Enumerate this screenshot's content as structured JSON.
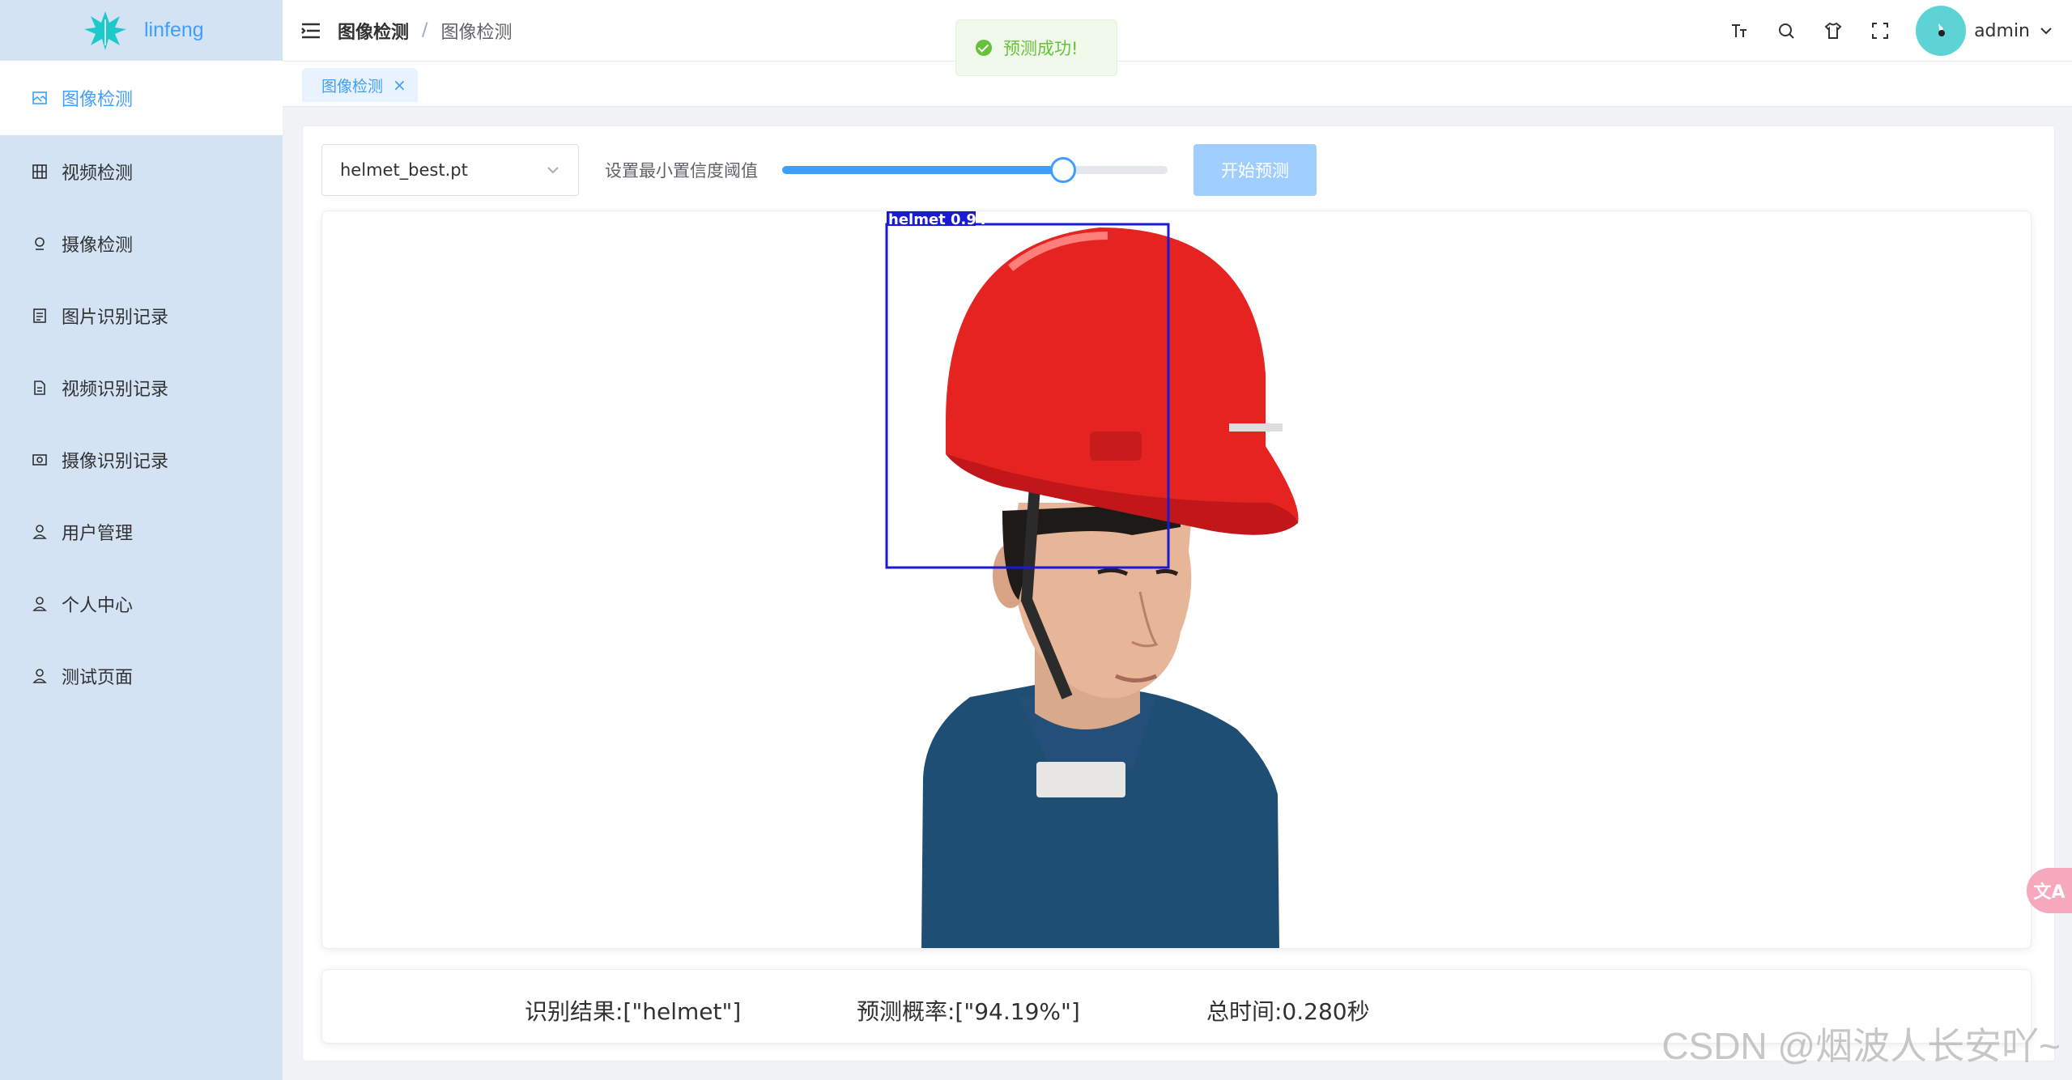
{
  "app": {
    "name": "linfeng"
  },
  "sidebar": {
    "items": [
      {
        "label": "图像检测",
        "icon": "image-icon",
        "active": true
      },
      {
        "label": "视频检测",
        "icon": "video-icon",
        "active": false
      },
      {
        "label": "摄像检测",
        "icon": "camera-icon",
        "active": false
      },
      {
        "label": "图片识别记录",
        "icon": "document-icon",
        "active": false
      },
      {
        "label": "视频识别记录",
        "icon": "file-icon",
        "active": false
      },
      {
        "label": "摄像识别记录",
        "icon": "monitor-icon",
        "active": false
      },
      {
        "label": "用户管理",
        "icon": "user-icon",
        "active": false
      },
      {
        "label": "个人中心",
        "icon": "user-icon",
        "active": false
      },
      {
        "label": "测试页面",
        "icon": "user-icon",
        "active": false
      }
    ]
  },
  "header": {
    "breadcrumb": [
      "图像检测",
      "图像检测"
    ],
    "user": "admin"
  },
  "toast": {
    "message": "预测成功!"
  },
  "tags": [
    {
      "label": "图像检测"
    }
  ],
  "toolbar": {
    "model_select": "helmet_best.pt",
    "slider_label": "设置最小置信度阈值",
    "slider_value": 0.73,
    "predict_button": "开始预测"
  },
  "detection": {
    "label": "helmet  0.94",
    "box_color": "#1a1ad6"
  },
  "results": {
    "result_text": "识别结果:[\"helmet\"]",
    "probability_text": "预测概率:[\"94.19%\"]",
    "time_text": "总时间:0.280秒"
  },
  "watermark": "CSDN @烟波人长安吖~",
  "colors": {
    "accent": "#409eff",
    "sidebar_bg": "#d3e3f4",
    "success": "#67c23a"
  }
}
